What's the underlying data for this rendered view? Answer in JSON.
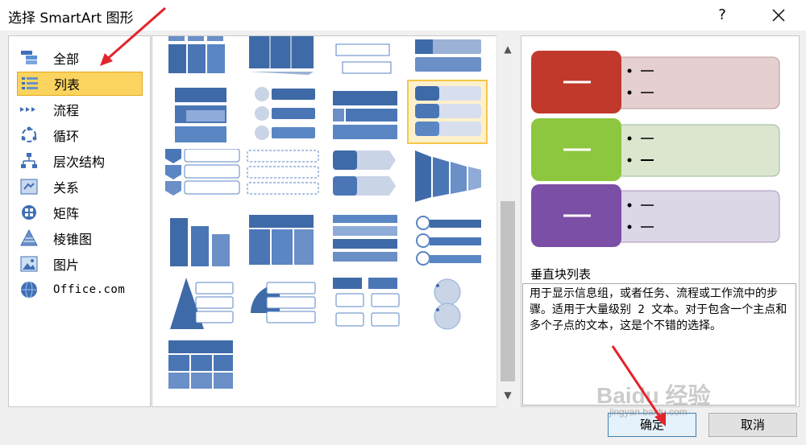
{
  "window": {
    "title": "选择 SmartArt 图形",
    "help_label": "?",
    "close_icon": "close-icon"
  },
  "categories": [
    {
      "label": "全部",
      "icon": "all-icon",
      "selected": false
    },
    {
      "label": "列表",
      "icon": "list-icon",
      "selected": true
    },
    {
      "label": "流程",
      "icon": "process-icon",
      "selected": false
    },
    {
      "label": "循环",
      "icon": "cycle-icon",
      "selected": false
    },
    {
      "label": "层次结构",
      "icon": "hierarchy-icon",
      "selected": false
    },
    {
      "label": "关系",
      "icon": "relationship-icon",
      "selected": false
    },
    {
      "label": "矩阵",
      "icon": "matrix-icon",
      "selected": false
    },
    {
      "label": "棱锥图",
      "icon": "pyramid-icon",
      "selected": false
    },
    {
      "label": "图片",
      "icon": "picture-icon",
      "selected": false
    },
    {
      "label": "Office.com",
      "icon": "office-com-icon",
      "selected": false
    }
  ],
  "gallery": {
    "selected_index": 7,
    "scroll_up": "▲",
    "scroll_down": "▼"
  },
  "preview": {
    "layout_name": "垂直块列表",
    "description": "用于显示信息组，或者任务、流程或工作流中的步骤。适用于大量级别 2 文本。对于包含一个主点和多个子点的文本，这是个不错的选择。",
    "block_colors": [
      "#c0392b",
      "#8dc63f",
      "#7b4fa6"
    ],
    "bullet_panel_colors": [
      "#e6cfd0",
      "#dce6cf",
      "#ddd6e6"
    ]
  },
  "buttons": {
    "ok": "确定",
    "cancel": "取消"
  },
  "watermark": {
    "brand": "Baidu 经验",
    "url": "jingyan.baidu.com"
  }
}
